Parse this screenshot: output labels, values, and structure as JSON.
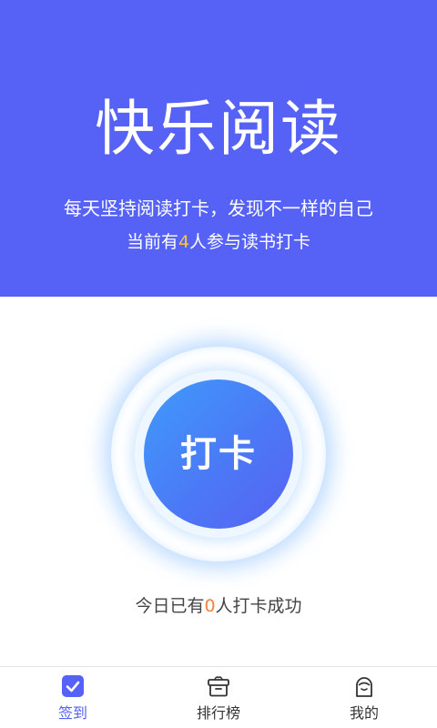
{
  "header": {
    "title": "快乐阅读",
    "subtitle": "每天坚持阅读打卡，发现不一样的自己",
    "count_prefix": "当前有",
    "count_value": "4",
    "count_suffix": "人参与读书打卡"
  },
  "checkin": {
    "button_label": "打卡",
    "status_prefix": "今日已有",
    "status_value": "0",
    "status_suffix": "人打卡成功"
  },
  "tabbar": {
    "tabs": [
      {
        "label": "签到",
        "icon": "check-square-icon",
        "active": true
      },
      {
        "label": "排行榜",
        "icon": "ranking-box-icon",
        "active": false
      },
      {
        "label": "我的",
        "icon": "profile-icon",
        "active": false
      }
    ]
  },
  "colors": {
    "primary": "#5562f5",
    "highlight_yellow": "#f8c644",
    "highlight_orange": "#f5813a",
    "button_gradient_start": "#3f9bfb",
    "button_gradient_end": "#5862f2"
  }
}
